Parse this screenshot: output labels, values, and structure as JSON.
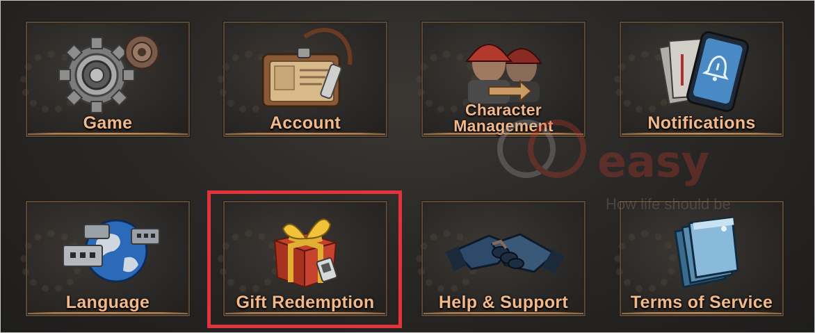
{
  "menu": {
    "tiles": [
      {
        "label": "Game",
        "icon": "gears-icon"
      },
      {
        "label": "Account",
        "icon": "id-card-icon"
      },
      {
        "label": "Character\nManagement",
        "label_line1": "Character",
        "label_line2": "Management",
        "icon": "character-swap-icon"
      },
      {
        "label": "Notifications",
        "icon": "phone-bell-icon"
      },
      {
        "label": "Language",
        "icon": "globe-chat-icon"
      },
      {
        "label": "Gift Redemption",
        "icon": "gift-box-icon"
      },
      {
        "label": "Help & Support",
        "icon": "handshake-icon"
      },
      {
        "label": "Terms of Service",
        "icon": "documents-icon"
      }
    ]
  },
  "highlight": {
    "target": "Gift Redemption",
    "color": "#e2323a"
  },
  "watermark": {
    "brand": "easy",
    "tagline": "How life should be"
  },
  "colors": {
    "label": "#f1b88a",
    "background": "#2a2826",
    "tile_border": "#5a4a3a",
    "tile_accent": "#c98b55"
  }
}
